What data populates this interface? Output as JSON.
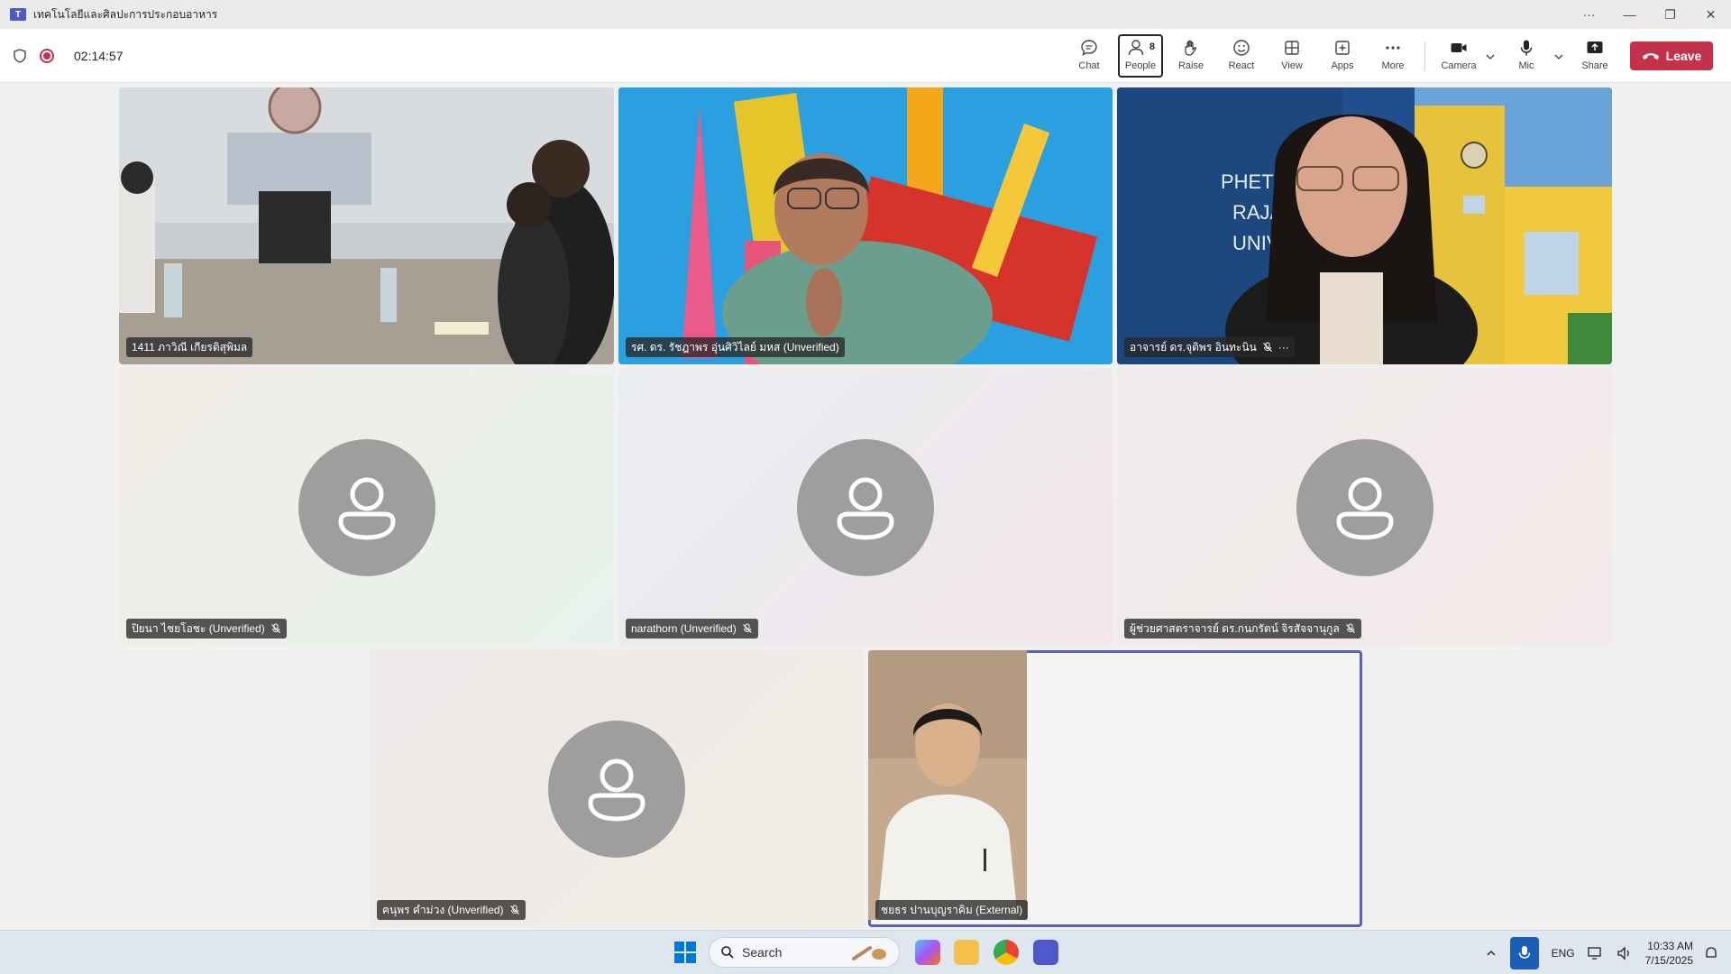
{
  "window": {
    "title": "เทคโนโลยีและศิลปะการประกอบอาหาร",
    "controls": [
      "···",
      "—",
      "❐",
      "✕"
    ]
  },
  "meeting": {
    "timer": "02:14:57",
    "toolbar": {
      "chat": "Chat",
      "people": "People",
      "people_count": "8",
      "raise": "Raise",
      "react": "React",
      "view": "View",
      "apps": "Apps",
      "more": "More",
      "camera": "Camera",
      "mic": "Mic",
      "share": "Share",
      "leave": "Leave"
    }
  },
  "participants": [
    {
      "name": "1411 ภาวิณี เกียรติสุพิมล",
      "video": true,
      "muted": false
    },
    {
      "name": "รศ. ดร. รัชฎาพร อุ่นศิวิไลย์ มหส (Unverified)",
      "video": true,
      "muted": false,
      "speaking": true
    },
    {
      "name": "อาจารย์ ดร.จุติพร อินทะนิน",
      "video": true,
      "muted": true,
      "more": "···"
    },
    {
      "name": "ปิยนา ไชยโอชะ (Unverified)",
      "video": false,
      "muted": true
    },
    {
      "name": "narathorn (Unverified)",
      "video": false,
      "muted": true
    },
    {
      "name": "ผู้ช่วยศาสตราจารย์ ดร.กนกรัตน์ จิรสัจจานุกูล",
      "video": false,
      "muted": true
    },
    {
      "name": "ฅนุพร คำม่วง (Unverified)",
      "video": false,
      "muted": true
    },
    {
      "name": "ชยธร ปานบุญราคิม (External)",
      "video": true,
      "muted": false,
      "speaking": true
    }
  ],
  "taskbar": {
    "search_placeholder": "Search",
    "language": "ENG",
    "time": "10:33 AM",
    "date": "7/15/2025"
  },
  "colors": {
    "accent": "#5b5fc7",
    "leave": "#c4314b",
    "avatar": "#9e9e9e"
  }
}
